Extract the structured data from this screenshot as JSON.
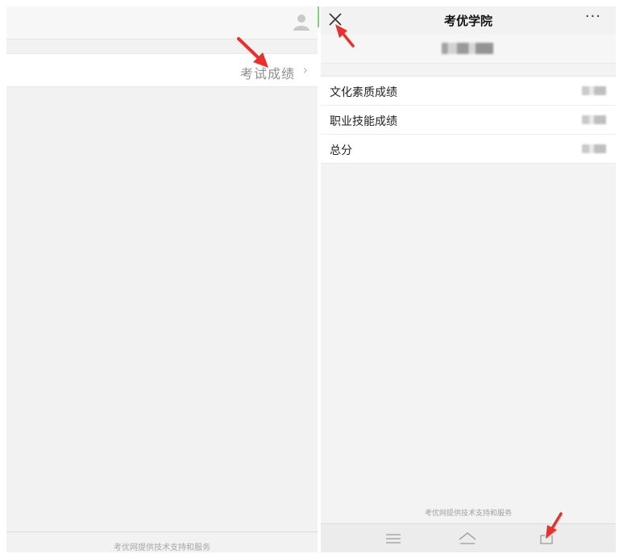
{
  "left_panel": {
    "row_label": "考试成绩",
    "row_chevron": "›",
    "footer": "考优网提供技术支持和服务",
    "icons": {
      "avatar": "user-avatar-icon"
    }
  },
  "right_panel": {
    "title": "考优学院",
    "more_glyph": "···",
    "scores": [
      {
        "label": "文化素质成绩"
      },
      {
        "label": "职业技能成绩"
      },
      {
        "label": "总分"
      }
    ],
    "footer": "考优网提供技术支持和服务",
    "icons": {
      "close": "close-icon",
      "more": "more-icon",
      "menu": "menu-icon",
      "home": "home-icon",
      "share": "share-icon"
    }
  },
  "colors": {
    "annotation_arrow": "#e8312a",
    "panel_background": "#f2f2f2",
    "divider_accent": "#7ed37e"
  }
}
